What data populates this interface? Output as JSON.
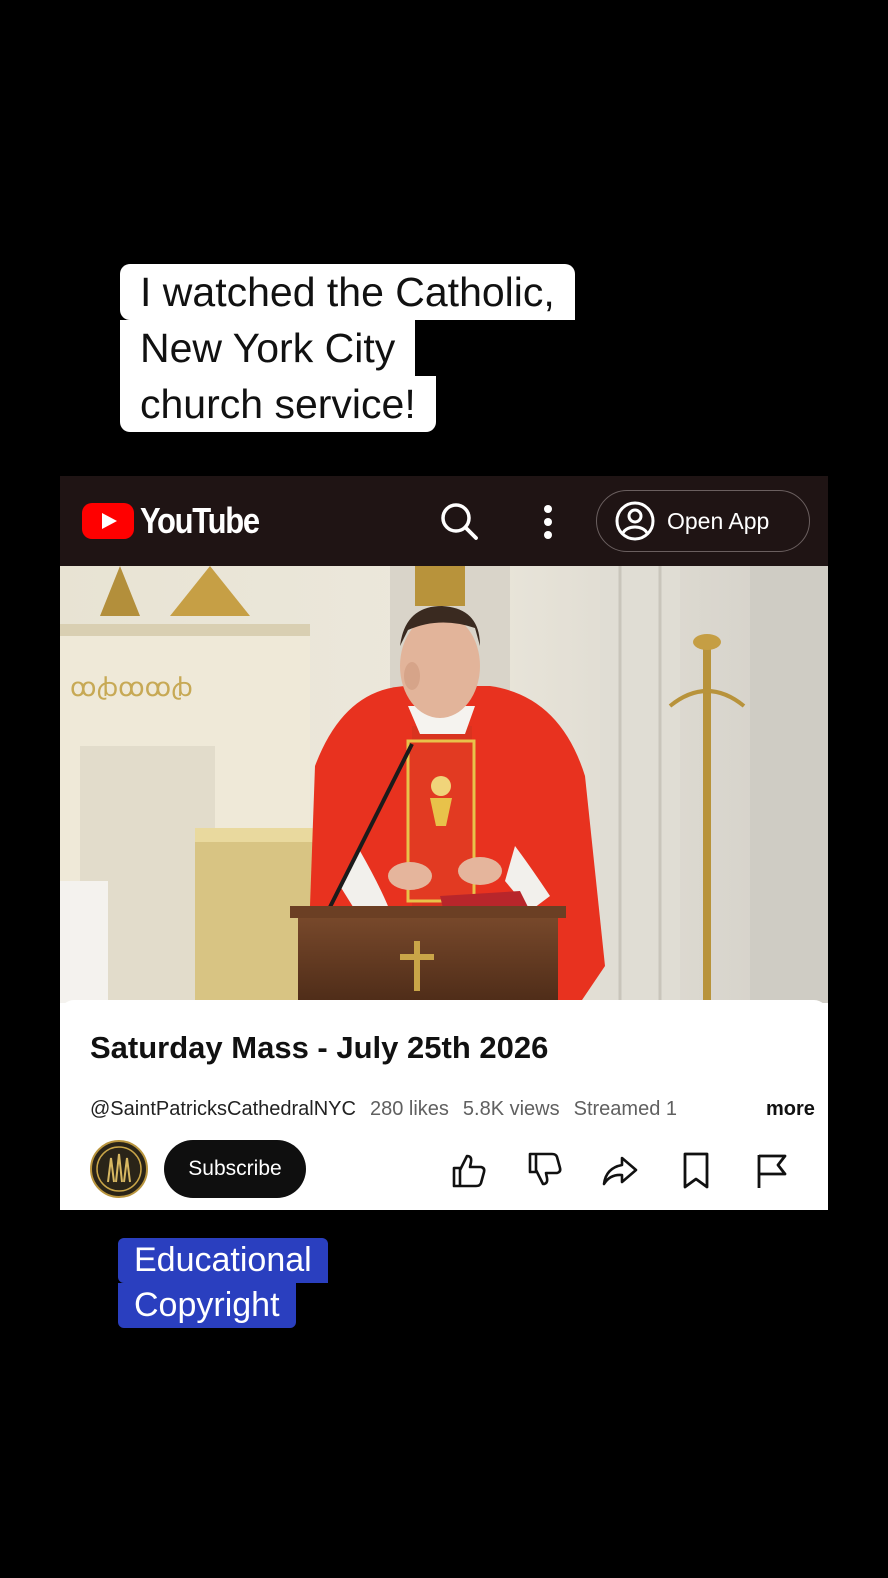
{
  "caption": {
    "lines": [
      "I watched the Catholic,",
      "New York City",
      "church service!"
    ]
  },
  "youtube": {
    "logo_text": "YouTube",
    "open_app_label": "Open App",
    "icons": {
      "logo": "youtube-play-icon",
      "search": "search-icon",
      "menu": "more-vertical-icon",
      "account": "account-circle-icon"
    },
    "video": {
      "thumbnail": "priest-in-red-vestments-at-pulpit"
    },
    "details": {
      "title": "Saturday Mass - July 25th 2026",
      "channel": "@SaintPatricksCathedralNYC",
      "likes": "280 likes",
      "views": "5.8K views",
      "streamed": "Streamed 1",
      "more_label": "more",
      "subscribe_label": "Subscribe",
      "actions": [
        "like-icon",
        "dislike-icon",
        "share-icon",
        "save-icon",
        "report-flag-icon"
      ]
    }
  },
  "overlay_label": {
    "lines": [
      "Educational",
      "Copyright"
    ]
  },
  "colors": {
    "youtube_red": "#ff0000",
    "top_bar": "#1f1414",
    "vestment_red": "#e8321f",
    "label_blue": "#2a3fbf"
  }
}
